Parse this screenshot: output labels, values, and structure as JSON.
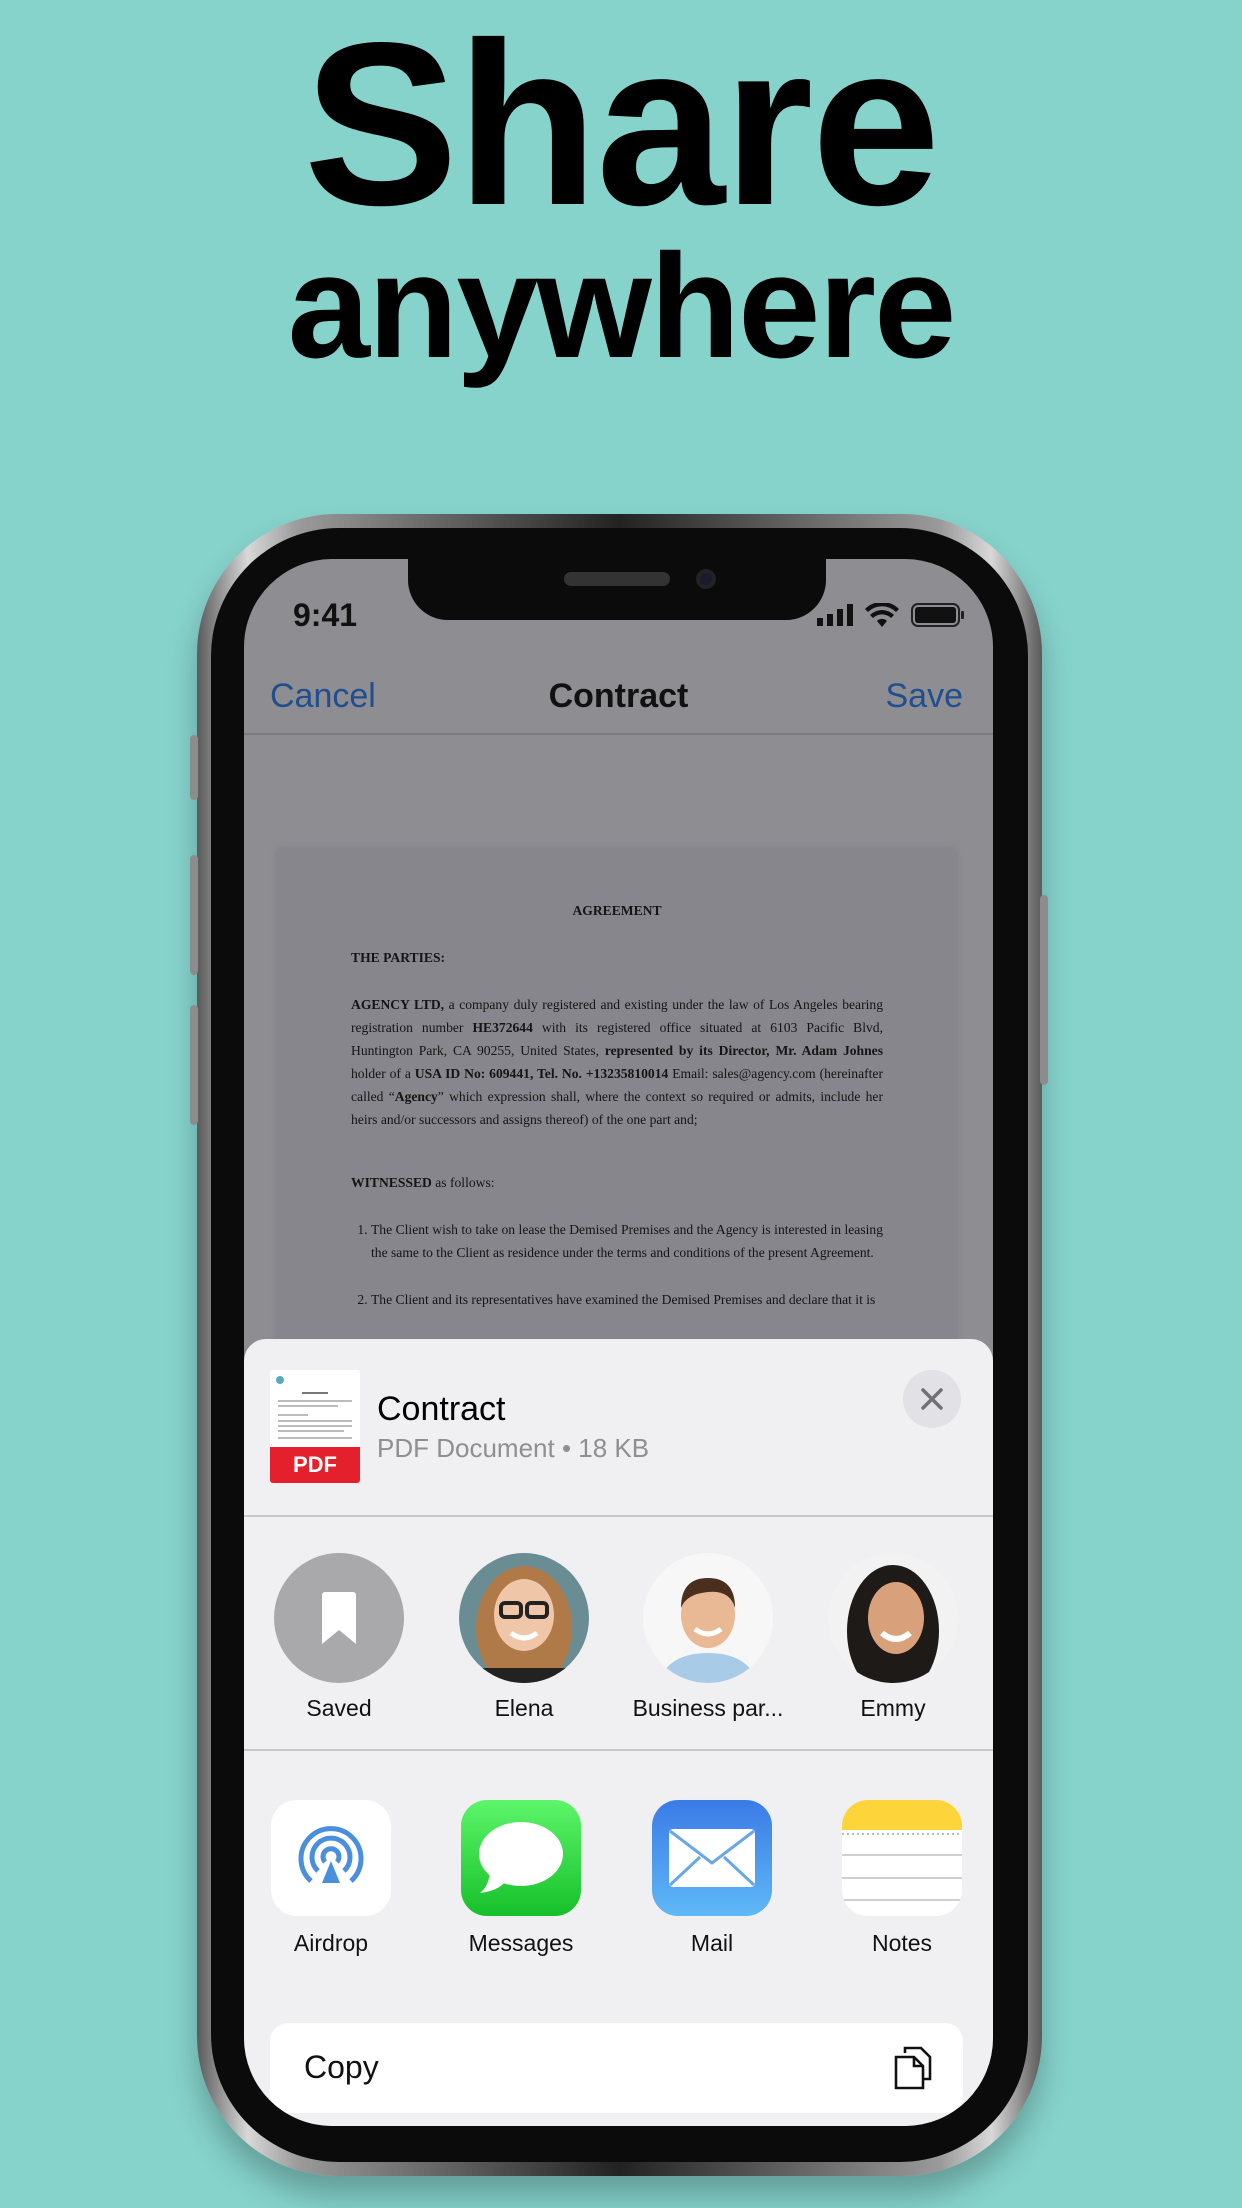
{
  "headline": {
    "line1": "Share",
    "line2": "anywhere"
  },
  "status_bar": {
    "time": "9:41",
    "icons": [
      "cellular-signal-icon",
      "wifi-icon",
      "battery-icon"
    ]
  },
  "nav": {
    "cancel": "Cancel",
    "title": "Contract",
    "save": "Save",
    "accent": "#1f4f8f"
  },
  "document": {
    "title": "AGREEMENT",
    "section1": "THE PARTIES:",
    "para1_bold1": "AGENCY LTD,",
    "para1_t1": " a company duly registered and existing under the law of Los Angeles bearing registration number ",
    "para1_bold2": "HE372644",
    "para1_t2": " with its registered office situated at 6103 Pacific Blvd, Huntington Park, CA 90255, United States, ",
    "para1_bold3": "represented by its Director, Mr. Adam Johnes",
    "para1_t3": " holder of a ",
    "para1_bold4": "USA ID No: 609441, Tel. No. +13235810014",
    "para1_t4": " Email: sales@agency.com (hereinafter called “",
    "para1_bold5": "Agency",
    "para1_t5": "” which expression shall, where the context so required or admits, include her heirs and/or successors and assigns thereof) of the one part and;",
    "section2_bold": "WITNESSED",
    "section2_rest": " as follows:",
    "items": [
      "The Client wish to take on lease the Demised Premises and the Agency is interested in leasing the same to the Client as residence under the terms and conditions of the present Agreement.",
      "The Client and its representatives have examined the Demised Premises and declare that it is"
    ]
  },
  "share_sheet": {
    "file_name": "Contract",
    "file_meta": "PDF Document • 18 KB",
    "thumb_badge": "PDF",
    "thumb_color": "#e3202c",
    "contacts": [
      {
        "label": "Saved",
        "icon": "bookmark-icon"
      },
      {
        "label": "Elena"
      },
      {
        "label": "Business par..."
      },
      {
        "label": "Emmy"
      }
    ],
    "apps": [
      {
        "label": "Airdrop",
        "icon": "airdrop-icon"
      },
      {
        "label": "Messages",
        "icon": "messages-icon"
      },
      {
        "label": "Mail",
        "icon": "mail-icon"
      },
      {
        "label": "Notes",
        "icon": "notes-icon"
      }
    ],
    "copy": "Copy"
  },
  "colors": {
    "background": "#86d3cc"
  }
}
